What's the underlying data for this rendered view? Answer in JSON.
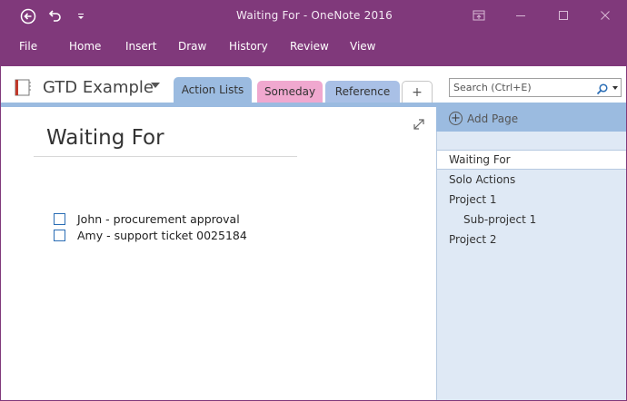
{
  "window": {
    "title": "Waiting For  -  OneNote 2016"
  },
  "ribbon": {
    "tabs": [
      "File",
      "Home",
      "Insert",
      "Draw",
      "History",
      "Review",
      "View"
    ]
  },
  "notebook": {
    "name": "GTD Example"
  },
  "sections": {
    "tabs": [
      {
        "label": "Action Lists",
        "color": "#9bbbe0"
      },
      {
        "label": "Someday",
        "color": "#f0a8cf"
      },
      {
        "label": "Reference",
        "color": "#a9c0e6"
      }
    ],
    "add_label": "+"
  },
  "search": {
    "placeholder": "Search (Ctrl+E)"
  },
  "page": {
    "title": "Waiting For",
    "todos": [
      {
        "text": "John - procurement approval",
        "checked": false
      },
      {
        "text": "Amy - support ticket 0025184",
        "checked": false
      }
    ]
  },
  "pages_panel": {
    "add_page_label": "Add Page",
    "pages": [
      {
        "label": "Waiting For",
        "selected": true,
        "level": 0
      },
      {
        "label": "Solo Actions",
        "selected": false,
        "level": 0
      },
      {
        "label": "Project 1",
        "selected": false,
        "level": 0
      },
      {
        "label": "Sub-project 1",
        "selected": false,
        "level": 1
      },
      {
        "label": "Project 2",
        "selected": false,
        "level": 0
      }
    ]
  },
  "colors": {
    "brand": "#80397b",
    "section_accent": "#9bbbe0",
    "panel_bg": "#dfe9f5"
  }
}
